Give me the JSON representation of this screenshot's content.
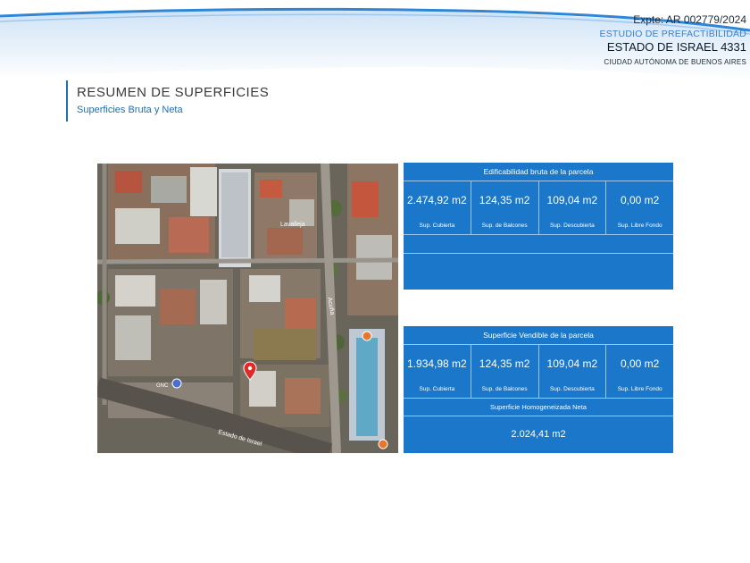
{
  "header": {
    "expte": "Expte: AR 002779/2024",
    "estudio": "ESTUDIO DE PREFACTIBILIDAD",
    "estado": "ESTADO DE ISRAEL 4331",
    "ciudad": "CIUDAD AUTÓNOMA DE BUENOS AIRES"
  },
  "title": "RESUMEN DE SUPERFICIES",
  "subtitle": "Superficies Bruta y Neta",
  "map": {
    "labels": {
      "lavalleja": "Lavalleja",
      "acuna": "Acuña",
      "estado_israel": "Estado de Israel",
      "gnc": "GNC"
    },
    "pin_icon": "location-pin-icon"
  },
  "panel_bruta": {
    "title": "Edificabilidad bruta de la parcela",
    "cells": [
      {
        "value": "2.474,92 m2",
        "label": "Sup. Cubierta"
      },
      {
        "value": "124,35 m2",
        "label": "Sup. de Balcones"
      },
      {
        "value": "109,04 m2",
        "label": "Sup. Descubierta"
      },
      {
        "value": "0,00 m2",
        "label": "Sup. Libre Fondo"
      }
    ]
  },
  "panel_vendible": {
    "title": "Superficie Vendible de la parcela",
    "cells": [
      {
        "value": "1.934,98 m2",
        "label": "Sup. Cubierta"
      },
      {
        "value": "124,35 m2",
        "label": "Sup. de Balcones"
      },
      {
        "value": "109,04 m2",
        "label": "Sup. Descubierta"
      },
      {
        "value": "0,00 m2",
        "label": "Sup. Libre Fondo"
      }
    ],
    "homog_label": "Superficie Homogeneizada Neta",
    "homog_value": "2.024,41 m2"
  },
  "colors": {
    "panel_blue": "#1a77c9",
    "title_blue": "#1f6fb2",
    "accent_light_blue": "#3a7fd0"
  }
}
